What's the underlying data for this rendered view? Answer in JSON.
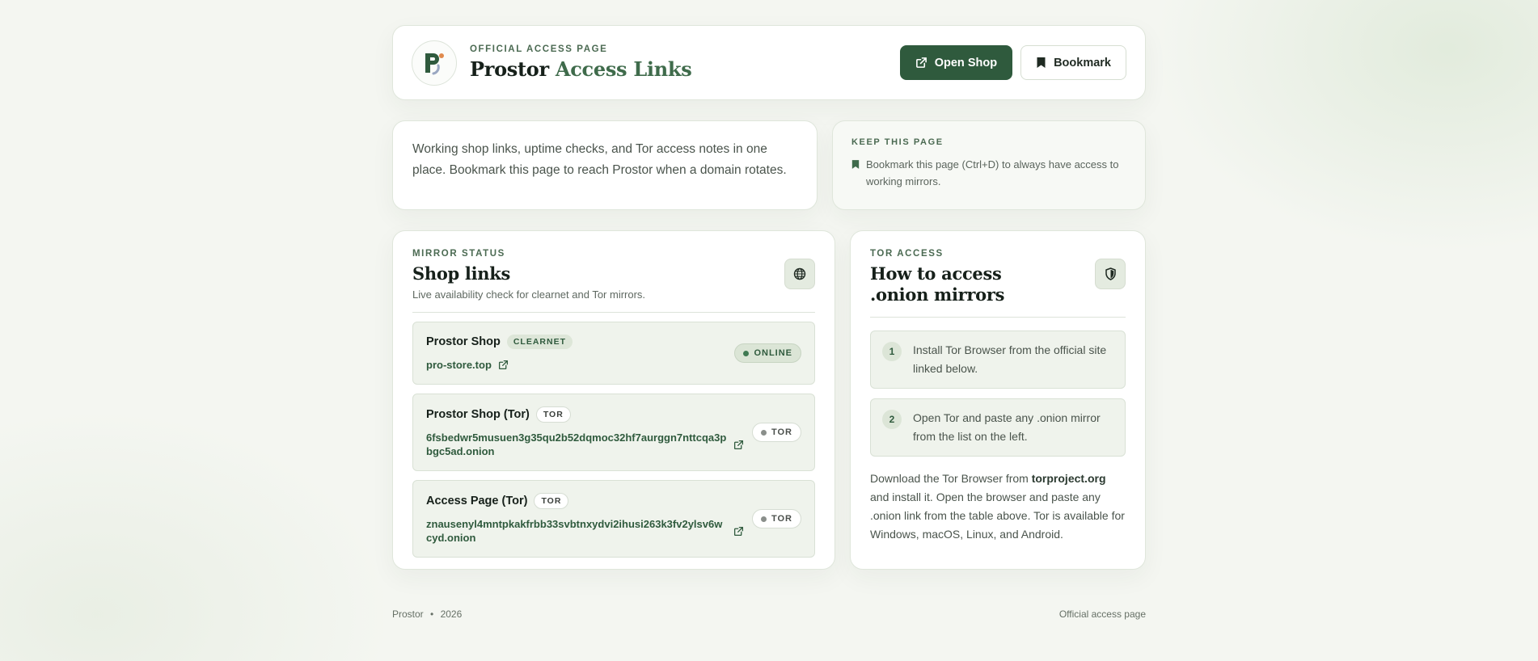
{
  "header": {
    "eyebrow": "Official access page",
    "title_main": "Prostor",
    "title_accent": "Access Links",
    "open_shop_label": "Open Shop",
    "bookmark_label": "Bookmark"
  },
  "intro": {
    "text": "Working shop links, uptime checks, and Tor access notes in one place. Bookmark this page to reach Prostor when a domain rotates."
  },
  "keep": {
    "eyebrow": "Keep this page",
    "text": "Bookmark this page (Ctrl+D) to always have access to working mirrors."
  },
  "mirrors": {
    "eyebrow": "Mirror status",
    "title": "Shop links",
    "subtitle": "Live availability check for clearnet and Tor mirrors.",
    "items": [
      {
        "name": "Prostor Shop",
        "tag": "Clearnet",
        "url": "pro-store.top",
        "status": "Online"
      },
      {
        "name": "Prostor Shop (Tor)",
        "tag": "Tor",
        "url": "6fsbedwr5musuen3g35qu2b52dqmoc32hf7aurggn7nttcqa3pbgc5ad.onion",
        "status": "Tor"
      },
      {
        "name": "Access Page (Tor)",
        "tag": "Tor",
        "url": "znausenyl4mntpkakfrbb33svbtnxydvi2ihusi263k3fv2ylsv6wcyd.onion",
        "status": "Tor"
      }
    ]
  },
  "tor": {
    "eyebrow": "Tor access",
    "title": "How to access .onion mirrors",
    "steps": [
      {
        "num": "1",
        "text": "Install Tor Browser from the official site linked below."
      },
      {
        "num": "2",
        "text": "Open Tor and paste any .onion mirror from the list on the left."
      }
    ],
    "note_before": "Download the Tor Browser from ",
    "note_link": "torproject.org",
    "note_after": " and install it. Open the browser and paste any .onion link from the table above. Tor is available for Windows, macOS, Linux, and Android."
  },
  "footer": {
    "brand": "Prostor",
    "separator": "•",
    "year": "2026",
    "right": "Official access page"
  },
  "colors": {
    "accent": "#2f5a3d",
    "background": "#f4f6f1",
    "online_dot": "#3f7a52",
    "tor_dot": "#8a8f8b"
  },
  "icons": [
    "prostor-logo-icon",
    "external-link-icon",
    "bookmark-icon",
    "globe-icon",
    "shield-icon"
  ]
}
